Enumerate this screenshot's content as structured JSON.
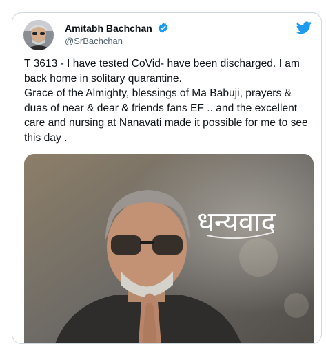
{
  "author": {
    "name": "Amitabh Bachchan",
    "handle": "@SrBachchan",
    "verified_icon": "verified-badge-icon",
    "brand_icon": "twitter-bird-icon",
    "brand_color": "#1d9bf0"
  },
  "tweet": {
    "text": "T 3613 - I have tested CoVid- have been discharged. I am back home in solitary quarantine.\nGrace of the Almighty, blessings of Ma Babuji, prayers & duas of near & dear & friends fans EF .. and the excellent care and nursing at Nanavati made it possible for me to see this day ."
  },
  "media": {
    "overlay_text": "धन्यवाद"
  }
}
